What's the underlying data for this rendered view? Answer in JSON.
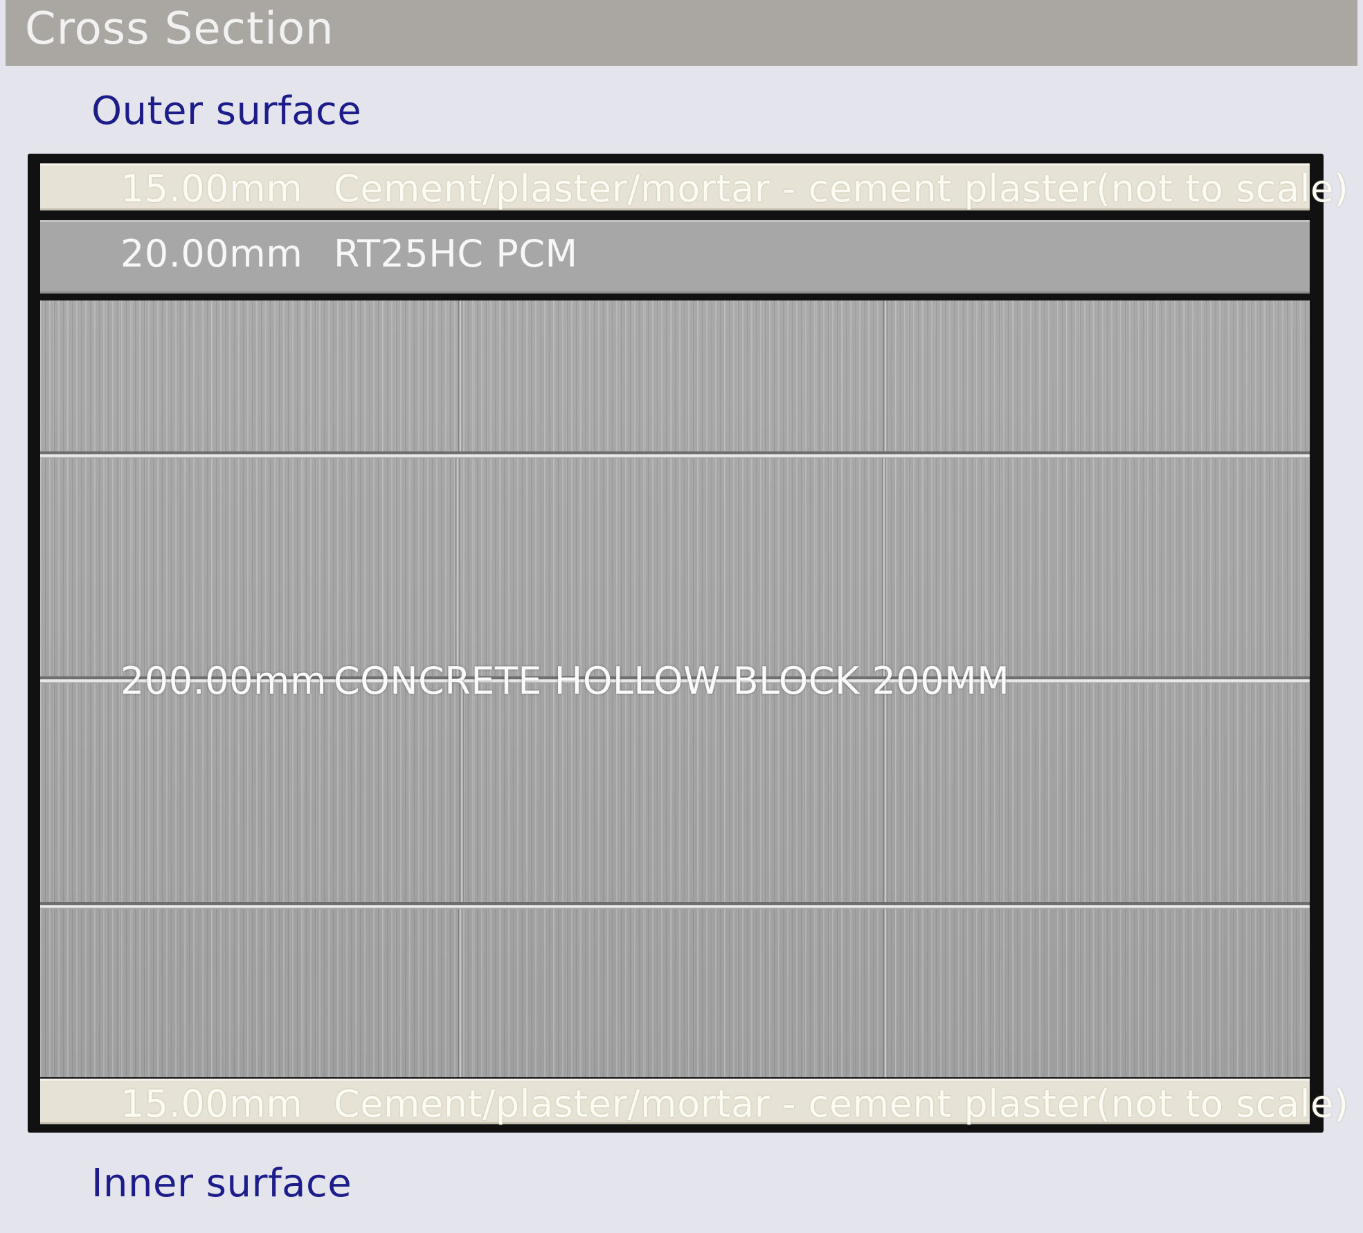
{
  "window": {
    "title": "Cross Section"
  },
  "surfaces": {
    "outer": "Outer surface",
    "inner": "Inner surface"
  },
  "layers": [
    {
      "thickness": "15.00mm",
      "material": "Cement/plaster/mortar - cement plaster(not to scale)"
    },
    {
      "thickness": "20.00mm",
      "material": "RT25HC PCM"
    },
    {
      "thickness": "200.00mm",
      "material": "CONCRETE HOLLOW BLOCK 200MM"
    },
    {
      "thickness": "15.00mm",
      "material": "Cement/plaster/mortar - cement plaster(not to scale)"
    }
  ],
  "colors": {
    "title_bar": "#aaa7a2",
    "background": "#e3e4ec",
    "surface_label": "#1c1d8a",
    "plaster": "#e6e2d5",
    "pcm": "#a7a7a7",
    "concrete": "#a4a4a4"
  }
}
